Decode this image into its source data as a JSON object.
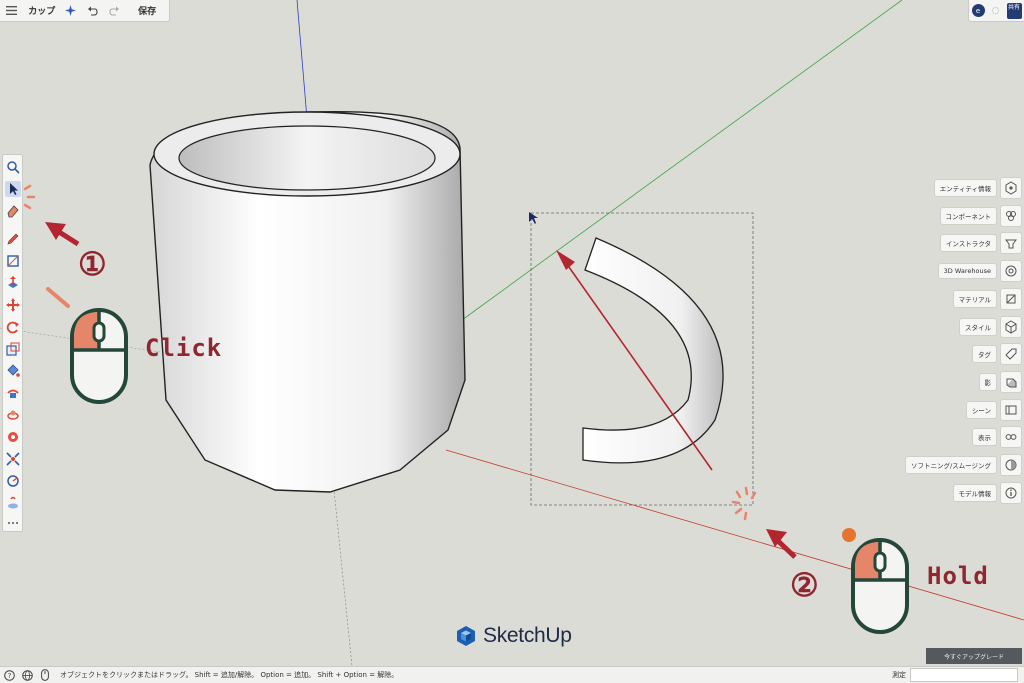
{
  "app": {
    "document_title": "カップ",
    "save_label": "保存",
    "logo_text": "SketchUp"
  },
  "topright": {
    "avatar_letter": "e",
    "share_label": "共有"
  },
  "left_tools": [
    {
      "name": "search-icon",
      "active": false
    },
    {
      "name": "select-icon",
      "active": true
    },
    {
      "name": "eraser-icon",
      "active": false
    },
    {
      "name": "pencil-icon",
      "active": false
    },
    {
      "name": "rectangle-icon",
      "active": false
    },
    {
      "name": "push-pull-icon",
      "active": false
    },
    {
      "name": "move-icon",
      "active": false
    },
    {
      "name": "rotate-icon",
      "active": false
    },
    {
      "name": "scale-icon",
      "active": false
    },
    {
      "name": "paint-bucket-icon",
      "active": false
    },
    {
      "name": "follow-me-icon",
      "active": false
    },
    {
      "name": "orbit-icon",
      "active": false
    },
    {
      "name": "position-camera-icon",
      "active": false
    },
    {
      "name": "zoom-extents-icon",
      "active": false
    },
    {
      "name": "tape-measure-icon",
      "active": false
    },
    {
      "name": "section-plane-icon",
      "active": false
    },
    {
      "name": "more-tools-icon",
      "active": false
    }
  ],
  "right_panel": [
    {
      "label": "エンティティ情報",
      "icon": "entity-info-icon"
    },
    {
      "label": "コンポーネント",
      "icon": "components-icon"
    },
    {
      "label": "インストラクタ",
      "icon": "instructor-icon"
    },
    {
      "label": "3D Warehouse",
      "icon": "warehouse-icon"
    },
    {
      "label": "マテリアル",
      "icon": "materials-icon"
    },
    {
      "label": "スタイル",
      "icon": "styles-icon"
    },
    {
      "label": "タグ",
      "icon": "tags-icon"
    },
    {
      "label": "影",
      "icon": "shadows-icon"
    },
    {
      "label": "シーン",
      "icon": "scenes-icon"
    },
    {
      "label": "表示",
      "icon": "display-icon"
    },
    {
      "label": "ソフトニング/スムージング",
      "icon": "soften-icon"
    },
    {
      "label": "モデル情報",
      "icon": "model-info-icon"
    }
  ],
  "upgrade_label": "今すぐアップグレード",
  "statusbar": {
    "hint": "オブジェクトをクリックまたはドラッグ。 Shift = 追加/解除。 Option = 追加。 Shift + Option = 解除。",
    "measure_label": "測定",
    "measure_value": ""
  },
  "annotations": {
    "step1_number": "①",
    "step2_number": "②",
    "click_label": "Click",
    "hold_label": "Hold"
  },
  "colors": {
    "annotation_red": "#8f2630",
    "mouse_orange": "#e5866b",
    "mouse_outline": "#24473a",
    "axis_red": "#c0392b",
    "axis_green": "#3fa34d",
    "axis_blue": "#2b3fd0"
  }
}
